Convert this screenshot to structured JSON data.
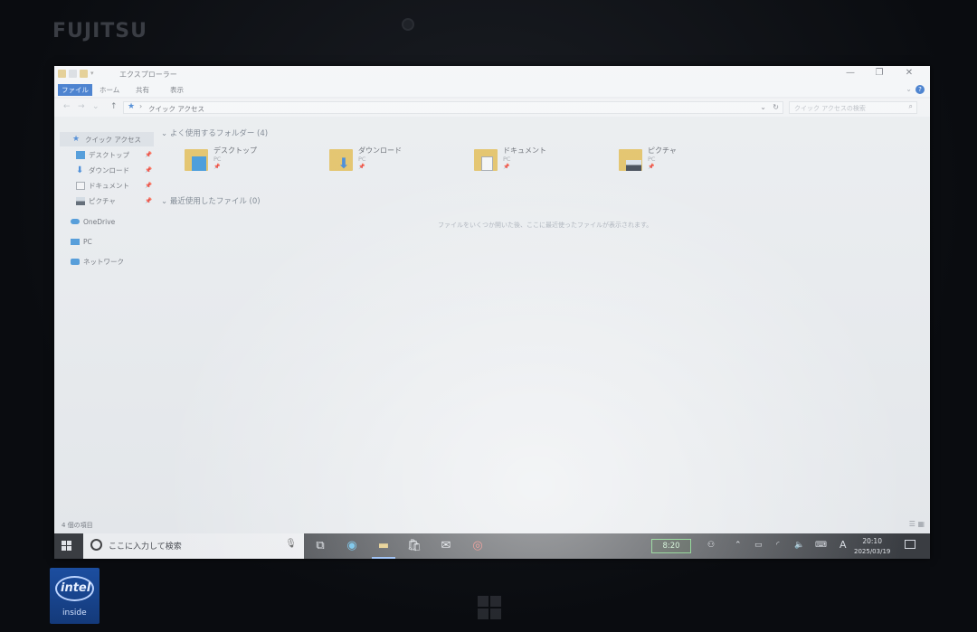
{
  "bezel": {
    "brand": "FUJITSU",
    "intel_badge": "intel",
    "intel_sub": "inside"
  },
  "window": {
    "title": "エクスプローラー",
    "controls": {
      "minimize": "—",
      "maximize": "❐",
      "close": "✕"
    },
    "ribbon_tabs": [
      "ファイル",
      "ホーム",
      "共有",
      "表示"
    ],
    "address": {
      "path": "クイック アクセス"
    },
    "search": {
      "placeholder": "クイック アクセスの検索"
    }
  },
  "nav_pane": {
    "quick_access": "クイック アクセス",
    "pinned": [
      "デスクトップ",
      "ダウンロード",
      "ドキュメント",
      "ピクチャ"
    ],
    "onedrive": "OneDrive",
    "pc": "PC",
    "network": "ネットワーク"
  },
  "content": {
    "frequent_header": "よく使用するフォルダー (4)",
    "folders": [
      {
        "name": "デスクトップ",
        "location": "PC"
      },
      {
        "name": "ダウンロード",
        "location": "PC"
      },
      {
        "name": "ドキュメント",
        "location": "PC"
      },
      {
        "name": "ピクチャ",
        "location": "PC"
      }
    ],
    "recent_header": "最近使用したファイル (0)",
    "recent_empty": "ファイルをいくつか開いた後、ここに最近使ったファイルが表示されます。"
  },
  "statusbar": {
    "count": "4 個の項目"
  },
  "taskbar": {
    "search_placeholder": "ここに入力して検索",
    "battery_time": "8:20",
    "ime": "A",
    "time": "20:10",
    "date": "2025/03/19"
  },
  "colors": {
    "accent": "#2f6fc8",
    "folder": "#e1bd5a",
    "taskbar": "#16191e",
    "battery": "#53c65b"
  }
}
